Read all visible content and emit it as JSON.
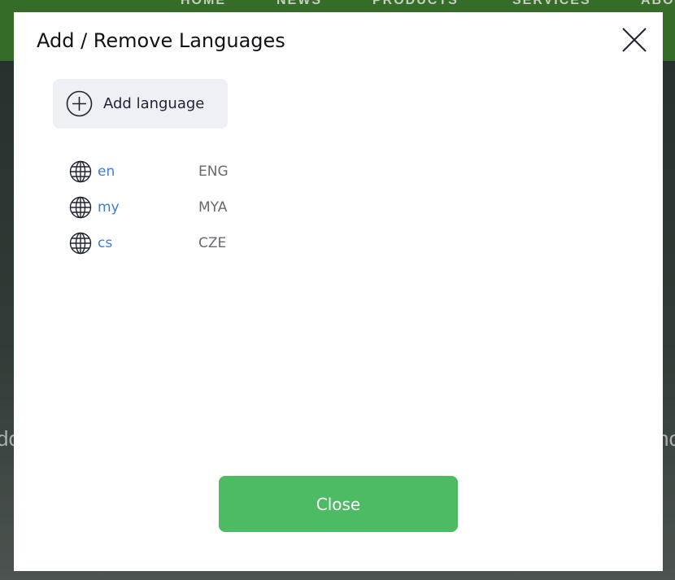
{
  "background": {
    "nav_items": [
      "HOME",
      "NEWS",
      "PRODUCTS",
      "SERVICES",
      "ABO"
    ],
    "left_fragment": "do",
    "right_fragment": "no"
  },
  "modal": {
    "title": "Add / Remove Languages",
    "close_icon": "close-x-icon",
    "add_button_label": "Add language",
    "add_icon": "plus-circle-icon",
    "languages": [
      {
        "code": "en",
        "iso": "ENG",
        "icon": "globe-icon"
      },
      {
        "code": "my",
        "iso": "MYA",
        "icon": "globe-icon"
      },
      {
        "code": "cs",
        "iso": "CZE",
        "icon": "globe-icon"
      }
    ],
    "close_button_label": "Close"
  },
  "colors": {
    "accent_green": "#4cbb63",
    "link_blue": "#3f7bd6",
    "nav_green": "#3f7f2e"
  }
}
